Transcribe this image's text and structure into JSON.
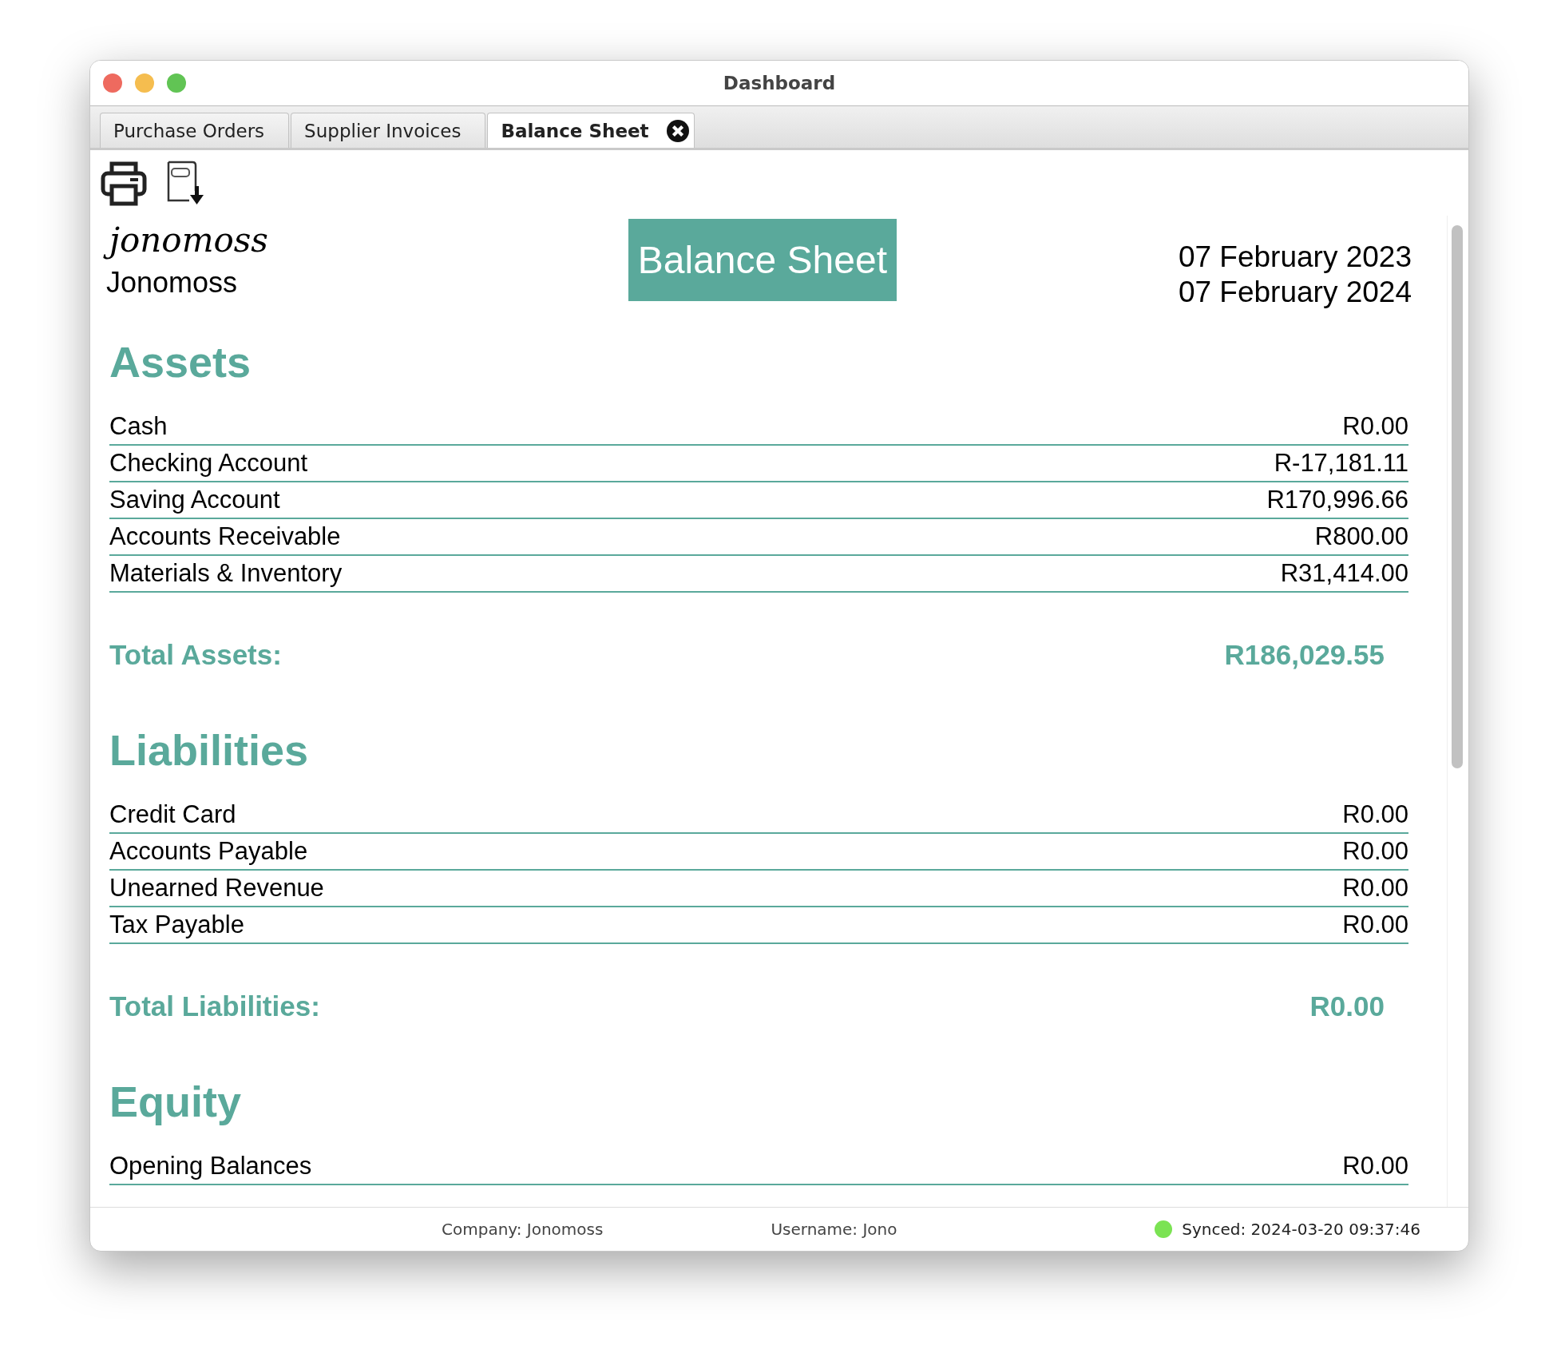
{
  "window": {
    "title": "Dashboard"
  },
  "tabs": [
    {
      "label": "Purchase Orders",
      "selected": false,
      "closable": false
    },
    {
      "label": "Supplier Invoices",
      "selected": false,
      "closable": false
    },
    {
      "label": "Balance Sheet",
      "selected": true,
      "closable": true
    }
  ],
  "report": {
    "logo_text": "jonomoss",
    "company": "Jonomoss",
    "title": "Balance Sheet",
    "dates": [
      "07 February 2023",
      "07 February 2024"
    ],
    "sections": [
      {
        "heading": "Assets",
        "rows": [
          {
            "label": "Cash",
            "amount": "R0.00"
          },
          {
            "label": "Checking Account",
            "amount": "R-17,181.11"
          },
          {
            "label": "Saving Account",
            "amount": "R170,996.66"
          },
          {
            "label": "Accounts Receivable",
            "amount": "R800.00"
          },
          {
            "label": "Materials & Inventory",
            "amount": "R31,414.00"
          }
        ],
        "total_label": "Total Assets:",
        "total": "R186,029.55"
      },
      {
        "heading": "Liabilities",
        "rows": [
          {
            "label": "Credit Card",
            "amount": "R0.00"
          },
          {
            "label": "Accounts Payable",
            "amount": "R0.00"
          },
          {
            "label": "Unearned Revenue",
            "amount": "R0.00"
          },
          {
            "label": "Tax Payable",
            "amount": "R0.00"
          }
        ],
        "total_label": "Total Liabilities:",
        "total": "R0.00"
      },
      {
        "heading": "Equity",
        "rows": [
          {
            "label": "Opening Balances",
            "amount": "R0.00"
          }
        ]
      }
    ]
  },
  "status_bar": {
    "company": "Company: Jonomoss",
    "username": "Username: Jono",
    "synced": true,
    "sync_text": "Synced: 2024-03-20 09:37:46"
  }
}
